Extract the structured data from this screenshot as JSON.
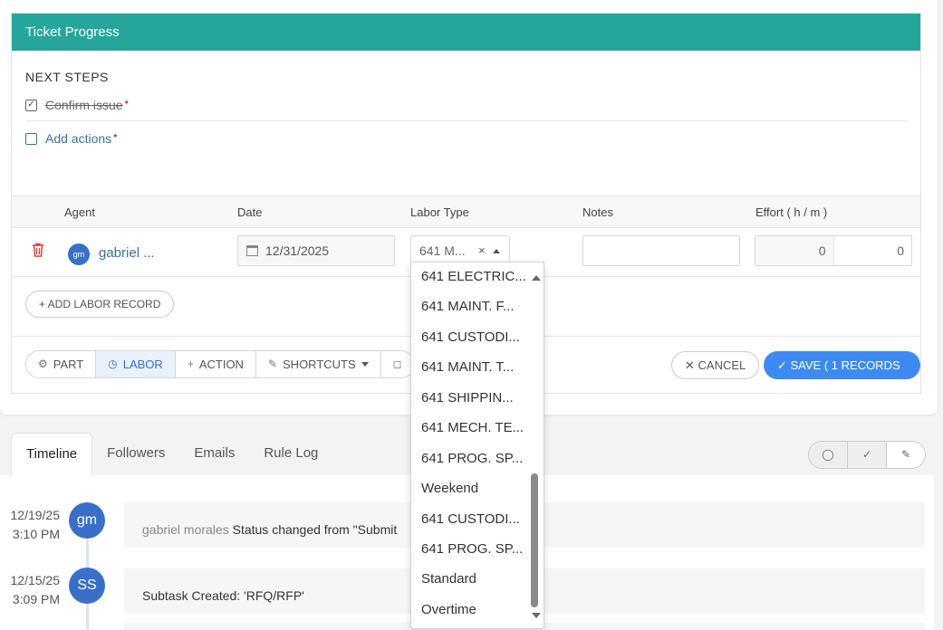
{
  "panel": {
    "title": "Ticket Progress",
    "next_steps_title": "NEXT STEPS",
    "steps": [
      {
        "label": "Confirm issue",
        "checked": true,
        "required": "•"
      },
      {
        "label": "Add actions",
        "checked": false,
        "required": "•"
      }
    ]
  },
  "labor_table": {
    "headers": {
      "agent": "Agent",
      "date": "Date",
      "labor_type": "Labor Type",
      "notes": "Notes",
      "effort": "Effort ( h / m )"
    },
    "row": {
      "avatar": "gm",
      "agent": "gabriel ...",
      "date": "12/31/2025",
      "labor_type": "641 M...",
      "clear": "×",
      "notes": "",
      "hours": "0",
      "minutes": "0"
    },
    "add_label": "+ ADD LABOR RECORD"
  },
  "toolbar": {
    "part": "PART",
    "labor": "LABOR",
    "action": "ACTION",
    "shortcuts": "SHORTCUTS",
    "cancel": "✕ CANCEL",
    "save": "✓ SAVE ( 1 RECORDS )"
  },
  "labor_type_options": [
    "641 ELECTRIC...",
    "641 MAINT. F...",
    "641 CUSTODI...",
    "641 MAINT. T...",
    "641 SHIPPIN...",
    "641 MECH. TE...",
    "641 PROG. SP...",
    "Weekend",
    "641 CUSTODI...",
    "641 PROG. SP...",
    "Standard",
    "Overtime"
  ],
  "tabs": [
    "Timeline",
    "Followers",
    "Emails",
    "Rule Log"
  ],
  "timeline": [
    {
      "date": "12/19/25",
      "time": "3:10 PM",
      "avatar": "gm",
      "who": "gabriel morales",
      "text": " Status changed from \"Submit"
    },
    {
      "date": "12/15/25",
      "time": "3:09 PM",
      "avatar": "SS",
      "who": "",
      "text": "Subtask Created: 'RFQ/RFP'"
    }
  ],
  "colors": {
    "header": "#26a69a",
    "primary": "#3d8bf2",
    "link": "#3a6fb0",
    "avatar": "#3a6fc9",
    "danger": "#e53935"
  }
}
